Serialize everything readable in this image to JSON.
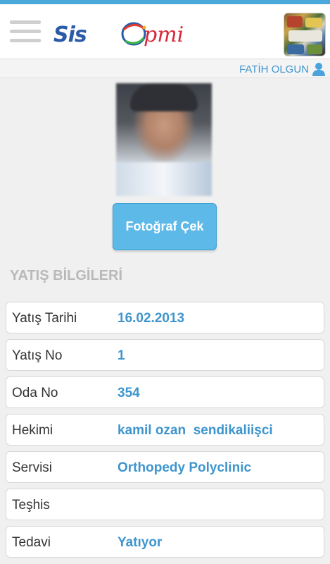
{
  "header": {
    "logo_sis": "Sis",
    "logo_pmi": "pmi"
  },
  "user": {
    "name": "FATİH OLGUN"
  },
  "photo_button": {
    "label": "Fotoğraf Çek"
  },
  "section": {
    "title": "YATIŞ BİLGİLERİ"
  },
  "info": [
    {
      "label": "Yatış Tarihi",
      "value": "16.02.2013"
    },
    {
      "label": "Yatış No",
      "value": "1"
    },
    {
      "label": "Oda No",
      "value": "354"
    },
    {
      "label": "Hekimi",
      "value": "kamil ozan  sendikaliişci"
    },
    {
      "label": "Servisi",
      "value": "Orthopedy Polyclinic"
    },
    {
      "label": "Teşhis",
      "value": ""
    },
    {
      "label": "Tedavi",
      "value": "Yatıyor"
    }
  ],
  "colors": {
    "accent": "#3e95cd",
    "button": "#5db9e8",
    "logo_blue": "#2a5aa8",
    "logo_red": "#d8283a"
  }
}
